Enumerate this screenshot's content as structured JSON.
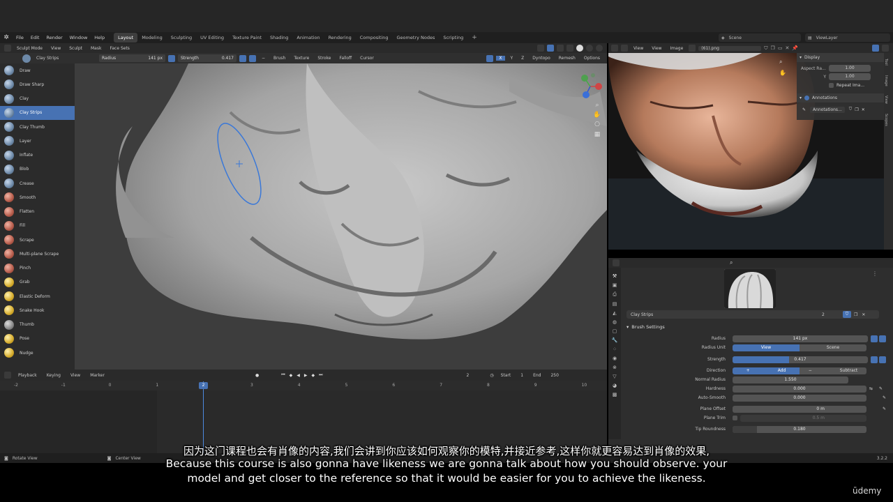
{
  "menu": {
    "items": [
      "File",
      "Edit",
      "Render",
      "Window",
      "Help"
    ],
    "workspaces": [
      "Layout",
      "Modeling",
      "Sculpting",
      "UV Editing",
      "Texture Paint",
      "Shading",
      "Animation",
      "Rendering",
      "Compositing",
      "Geometry Nodes",
      "Scripting"
    ],
    "active_workspace": "Layout",
    "scene": "Scene",
    "view_layer": "ViewLayer"
  },
  "viewport_header": {
    "mode": "Sculpt Mode",
    "items": [
      "View",
      "Sculpt",
      "Mask",
      "Face Sets"
    ],
    "axes": [
      "X",
      "Y",
      "Z"
    ],
    "dyntopo": "Dyntopo",
    "remesh": "Remesh",
    "options": "Options"
  },
  "tool_header": {
    "brush": "Clay Strips",
    "radius_label": "Radius",
    "radius_value": "141 px",
    "strength_label": "Strength",
    "strength_value": "0.417",
    "menus": [
      "Brush",
      "Texture",
      "Stroke",
      "Falloff",
      "Cursor"
    ]
  },
  "tools": [
    {
      "label": "Draw",
      "color": "blue"
    },
    {
      "label": "Draw Sharp",
      "color": "blue"
    },
    {
      "label": "Clay",
      "color": "blue"
    },
    {
      "label": "Clay Strips",
      "color": "blue"
    },
    {
      "label": "Clay Thumb",
      "color": "blue"
    },
    {
      "label": "Layer",
      "color": "blue"
    },
    {
      "label": "Inflate",
      "color": "blue"
    },
    {
      "label": "Blob",
      "color": "blue"
    },
    {
      "label": "Crease",
      "color": "blue"
    },
    {
      "label": "Smooth",
      "color": "red"
    },
    {
      "label": "Flatten",
      "color": "red"
    },
    {
      "label": "Fill",
      "color": "red"
    },
    {
      "label": "Scrape",
      "color": "red"
    },
    {
      "label": "Multi-plane Scrape",
      "color": "red"
    },
    {
      "label": "Pinch",
      "color": "red"
    },
    {
      "label": "Grab",
      "color": "yellow"
    },
    {
      "label": "Elastic Deform",
      "color": "yellow"
    },
    {
      "label": "Snake Hook",
      "color": "yellow"
    },
    {
      "label": "Thumb",
      "color": "gray"
    },
    {
      "label": "Pose",
      "color": "yellow"
    },
    {
      "label": "Nudge",
      "color": "yellow"
    }
  ],
  "active_tool": "Clay Strips",
  "timeline": {
    "menus": [
      "Playback",
      "Keying",
      "View",
      "Marker"
    ],
    "current_frame": "2",
    "start_label": "Start",
    "start": "1",
    "end_label": "End",
    "end": "250",
    "ruler": [
      "-2",
      "-1",
      "0",
      "1",
      "2",
      "3",
      "4",
      "5",
      "6",
      "7",
      "8",
      "9",
      "10"
    ]
  },
  "image_editor": {
    "menus": [
      "View",
      "View",
      "Image"
    ],
    "image_name": "(61).png",
    "display_title": "Display",
    "aspect_label": "Aspect Ra...",
    "aspect_x": "1.00",
    "y_label": "Y",
    "aspect_y": "1.00",
    "repeat": "Repeat Ima...",
    "annotations_title": "Annotations",
    "annotations_item": "Annotations...",
    "side_tabs": [
      "Tool",
      "Image",
      "View",
      "Scopes"
    ]
  },
  "properties": {
    "brush_name": "Clay Strips",
    "users": "2",
    "section": "Brush Settings",
    "rows": {
      "radius": {
        "label": "Radius",
        "value": "141 px"
      },
      "radius_unit": {
        "label": "Radius Unit",
        "options": [
          "View",
          "Scene"
        ],
        "selected": "View"
      },
      "strength": {
        "label": "Strength",
        "value": "0.417",
        "fraction": 0.417
      },
      "direction": {
        "label": "Direction",
        "options": [
          "Add",
          "Subtract"
        ],
        "selected": "Add"
      },
      "normal_radius": {
        "label": "Normal Radius",
        "value": "1.550"
      },
      "hardness": {
        "label": "Hardness",
        "value": "0.000"
      },
      "auto_smooth": {
        "label": "Auto-Smooth",
        "value": "0.000"
      },
      "plane_offset": {
        "label": "Plane Offset",
        "value": "0 m"
      },
      "plane_trim": {
        "label": "Plane Trim",
        "value": "0.5 m"
      },
      "tip_roundness": {
        "label": "Tip Roundness",
        "value": "0.180"
      }
    }
  },
  "statusbar": {
    "left": "Rotate View",
    "center": "Center View",
    "version": "3.2.2"
  },
  "subtitles": {
    "zh": "因为这门课程也会有肖像的内容,我们会讲到你应该如何观察你的模特,并接近参考,这样你就更容易达到肖像的效果,",
    "en1": "Because this course is also gonna have likeness we are gonna talk about how you should observe. your",
    "en2": "model and get closer to the reference so that it would be easier for you to achieve the likeness."
  },
  "watermark": "ūdemy",
  "colors": {
    "accent": "#4772b3",
    "panel": "#2e2e2e",
    "viewport": "#3c3c3c"
  }
}
